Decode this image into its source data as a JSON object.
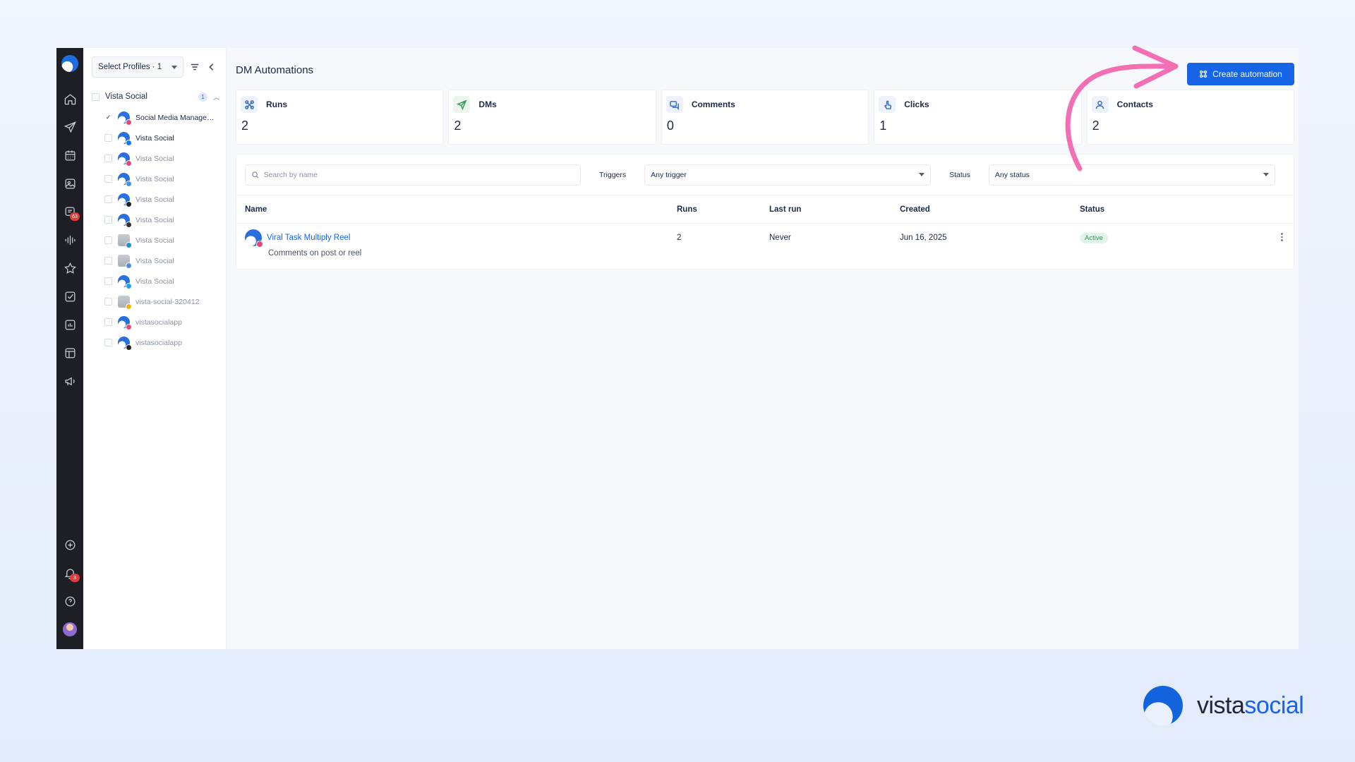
{
  "sidebar_profiles": {
    "select_label": "Select Profiles · 1",
    "group": {
      "name": "Vista Social",
      "count": "1"
    },
    "profiles": [
      {
        "name": "Social Media Managem...",
        "checked": true,
        "dim": false,
        "net_color": "#e8467a",
        "kind": "round"
      },
      {
        "name": "Vista Social",
        "checked": false,
        "dim": false,
        "net_color": "#1877f2",
        "kind": "round"
      },
      {
        "name": "Vista Social",
        "checked": false,
        "dim": true,
        "net_color": "#e8467a",
        "kind": "round"
      },
      {
        "name": "Vista Social",
        "checked": false,
        "dim": true,
        "net_color": "#4a90e2",
        "kind": "round"
      },
      {
        "name": "Vista Social",
        "checked": false,
        "dim": true,
        "net_color": "#222222",
        "kind": "round"
      },
      {
        "name": "Vista Social",
        "checked": false,
        "dim": true,
        "net_color": "#333333",
        "kind": "round"
      },
      {
        "name": "Vista Social",
        "checked": false,
        "dim": true,
        "net_color": "#1a8fd6",
        "kind": "building"
      },
      {
        "name": "Vista Social",
        "checked": false,
        "dim": true,
        "net_color": "#4a90e2",
        "kind": "building"
      },
      {
        "name": "Vista Social",
        "checked": false,
        "dim": true,
        "net_color": "#1da1f2",
        "kind": "round"
      },
      {
        "name": "vista-social-320412",
        "checked": false,
        "dim": true,
        "net_color": "#f4b400",
        "kind": "building"
      },
      {
        "name": "vistasocialapp",
        "checked": false,
        "dim": true,
        "net_color": "#e8467a",
        "kind": "round"
      },
      {
        "name": "vistasocialapp",
        "checked": false,
        "dim": true,
        "net_color": "#222222",
        "kind": "round"
      }
    ]
  },
  "rail": {
    "inbox_badge": "63",
    "notifications_badge": "3"
  },
  "header": {
    "title": "DM Automations",
    "create_button": "Create automation"
  },
  "stats": [
    {
      "label": "Runs",
      "value": "2",
      "icon": "runs-icon",
      "bg": "#eef3fb",
      "stroke": "#3d6fbf"
    },
    {
      "label": "DMs",
      "value": "2",
      "icon": "send-icon",
      "bg": "#eaf6ee",
      "stroke": "#3c9a5d"
    },
    {
      "label": "Comments",
      "value": "0",
      "icon": "comments-icon",
      "bg": "#eef3fb",
      "stroke": "#3d6fbf"
    },
    {
      "label": "Clicks",
      "value": "1",
      "icon": "click-icon",
      "bg": "#eef3fb",
      "stroke": "#3d6fbf"
    },
    {
      "label": "Contacts",
      "value": "2",
      "icon": "contacts-icon",
      "bg": "#eef3fb",
      "stroke": "#3d6fbf"
    }
  ],
  "filters": {
    "search_placeholder": "Search by name",
    "triggers_label": "Triggers",
    "trigger_value": "Any trigger",
    "status_label": "Status",
    "status_value": "Any status"
  },
  "table": {
    "columns": [
      "Name",
      "Runs",
      "Last run",
      "Created",
      "Status"
    ],
    "rows": [
      {
        "name": "Viral Task Multiply Reel",
        "subtitle": "Comments on post or reel",
        "runs": "2",
        "last_run": "Never",
        "created": "Jun 16, 2025",
        "status": "Active"
      }
    ]
  },
  "brand": {
    "part1": "vista",
    "part2": "social"
  },
  "colors": {
    "accent": "#1765e6",
    "annotation_arrow": "#f26fb4",
    "active_green": "#2c9a57"
  }
}
